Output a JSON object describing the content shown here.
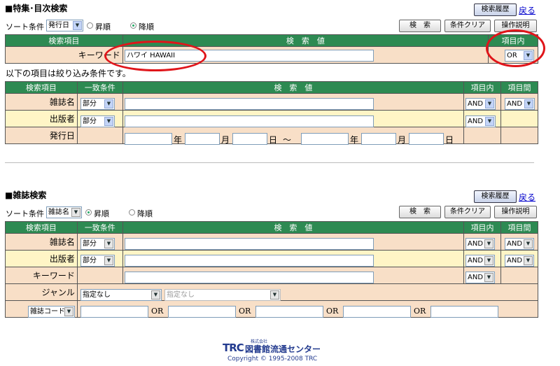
{
  "section1": {
    "title": "■特集･目次検索",
    "history_button": "検索履歴",
    "back_link": "戻る",
    "sort_label": "ソート条件",
    "sort_value": "発行日",
    "asc": "昇順",
    "desc": "降順",
    "search_button": "検　索",
    "clear_button": "条件クリア",
    "help_button": "操作説明",
    "headers": [
      "検索項目",
      "検　索　値",
      "項目内"
    ],
    "keyword_label": "キーワード",
    "keyword_value": "ハワイ HAWAII",
    "keyword_op": "OR",
    "note": "以下の項目は絞り込み条件です。",
    "filter_headers": [
      "検索項目",
      "一致条件",
      "検　索　値",
      "項目内",
      "項目間"
    ],
    "rows": [
      {
        "label": "雑誌名",
        "match": "部分",
        "inner": "AND",
        "between": "AND"
      },
      {
        "label": "出版者",
        "match": "部分",
        "inner": "AND"
      }
    ],
    "date_label": "発行日",
    "date_units": [
      "年",
      "月",
      "日",
      "〜",
      "年",
      "月",
      "日"
    ]
  },
  "section2": {
    "title": "■雑誌検索",
    "history_button": "検索履歴",
    "back_link": "戻る",
    "sort_label": "ソート条件",
    "sort_value": "雑誌名",
    "asc": "昇順",
    "desc": "降順",
    "search_button": "検　索",
    "clear_button": "条件クリア",
    "help_button": "操作説明",
    "headers": [
      "検索項目",
      "一致条件",
      "検　索　値",
      "項目内",
      "項目間"
    ],
    "rows": [
      {
        "label": "雑誌名",
        "match": "部分",
        "inner": "AND",
        "between": "AND"
      },
      {
        "label": "出版者",
        "match": "部分",
        "inner": "AND",
        "between": "AND"
      },
      {
        "label": "キーワード",
        "inner": "AND"
      }
    ],
    "genre_label": "ジャンル",
    "genre_value": "指定なし",
    "genre_sub_value": "指定なし",
    "code_select": "雑誌コード",
    "or_labels": [
      "OR",
      "OR",
      "OR",
      "OR"
    ]
  },
  "footer": {
    "logo_brand": "TRC",
    "logo_small": "株式会社",
    "logo_name": "図書館流通センター",
    "copyright": "Copyright © 1995-2008 TRC"
  },
  "colors": {
    "header_green": "#2d8a52",
    "row_peach": "#f8dfc7",
    "row_yellow": "#fff5c6",
    "annotation_red": "#e0151a"
  }
}
